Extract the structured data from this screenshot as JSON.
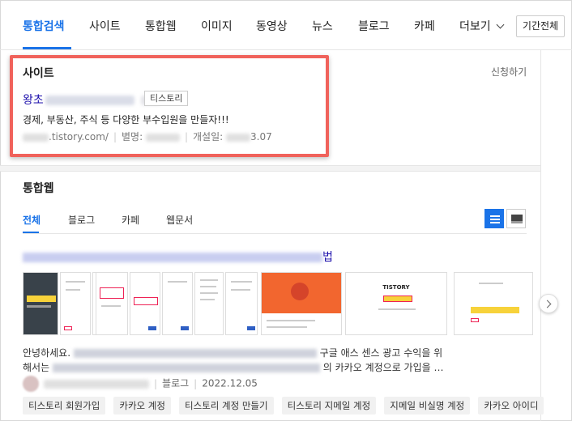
{
  "nav": {
    "items": [
      "통합검색",
      "사이트",
      "통합웹",
      "이미지",
      "동영상",
      "뉴스",
      "블로그",
      "카페"
    ],
    "more_label": "더보기",
    "period_label": "기간전체"
  },
  "site": {
    "section_title": "사이트",
    "apply_label": "신청하기",
    "link_prefix": "왕초",
    "tag_label": "티스토리",
    "description": "경제, 부동산, 주식 등 다양한 부수입원을 만들자!!!",
    "url_suffix": ".tistory.com/",
    "alias_label": "별명:",
    "opened_label": "개설일:",
    "opened_suffix": "3.07"
  },
  "web": {
    "section_title": "통합웹",
    "tabs": [
      "전체",
      "블로그",
      "카페",
      "웹문서"
    ],
    "result_link_suffix": "법",
    "snippet_start": "안녕하세요.",
    "snippet_mid": "구글 애스 센스 광고 수익을 위",
    "snippet_line2_start": "해서는",
    "snippet_line2_end": "의 카카오 계정으로 가입을 …",
    "source_type": "블로그",
    "source_date": "2022.12.05",
    "chips": [
      "티스토리 회원가입",
      "카카오 계정",
      "티스토리 계정 만들기",
      "티스토리 지메일 계정",
      "지메일 비실명 계정",
      "카카오 아이디"
    ],
    "thumb_brand": "TISTORY"
  },
  "colors": {
    "accent": "#1a73e8",
    "highlight_box": "#f0625b"
  }
}
